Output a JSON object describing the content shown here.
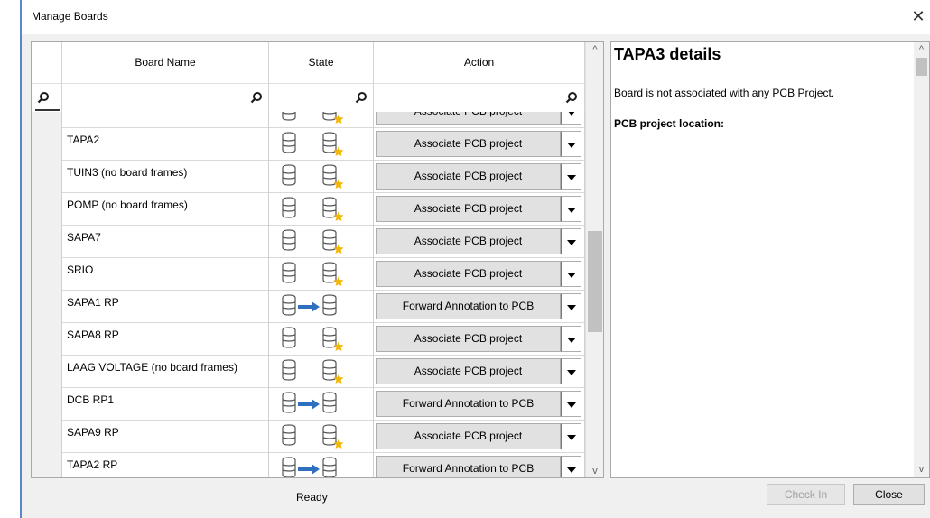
{
  "window": {
    "title": "Manage Boards",
    "close_glyph": "✕"
  },
  "grid": {
    "columns": {
      "board_name": "Board Name",
      "state": "State",
      "action": "Action"
    },
    "rows": [
      {
        "name": "",
        "state": "single",
        "action": "Associate PCB project"
      },
      {
        "name": "TAPA2",
        "state": "single",
        "action": "Associate PCB project"
      },
      {
        "name": "TUIN3 (no board frames)",
        "state": "single",
        "action": "Associate PCB project"
      },
      {
        "name": "POMP (no board frames)",
        "state": "single",
        "action": "Associate PCB project"
      },
      {
        "name": "SAPA7",
        "state": "single",
        "action": "Associate PCB project"
      },
      {
        "name": "SRIO",
        "state": "single",
        "action": "Associate PCB project"
      },
      {
        "name": "SAPA1 RP",
        "state": "linked",
        "action": "Forward Annotation to PCB"
      },
      {
        "name": "SAPA8 RP",
        "state": "single",
        "action": "Associate PCB project"
      },
      {
        "name": "LAAG VOLTAGE (no board frames)",
        "state": "single",
        "action": "Associate PCB project"
      },
      {
        "name": "DCB RP1",
        "state": "linked",
        "action": "Forward Annotation to PCB"
      },
      {
        "name": "SAPA9 RP",
        "state": "single",
        "action": "Associate PCB project"
      },
      {
        "name": "TAPA2 RP",
        "state": "linked",
        "action": "Forward Annotation to PCB"
      }
    ],
    "scroll_up": "^",
    "scroll_down": "v"
  },
  "details": {
    "title": "TAPA3 details",
    "line1": "Board is not associated with any PCB Project.",
    "line2": "PCB project location:",
    "scroll_up": "^",
    "scroll_down": "v"
  },
  "status": "Ready",
  "buttons": {
    "check_in": "Check In",
    "close": "Close"
  },
  "colors": {
    "accent": "#5b87c9",
    "arrow": "#2e6fbf",
    "star": "#f2b705"
  }
}
